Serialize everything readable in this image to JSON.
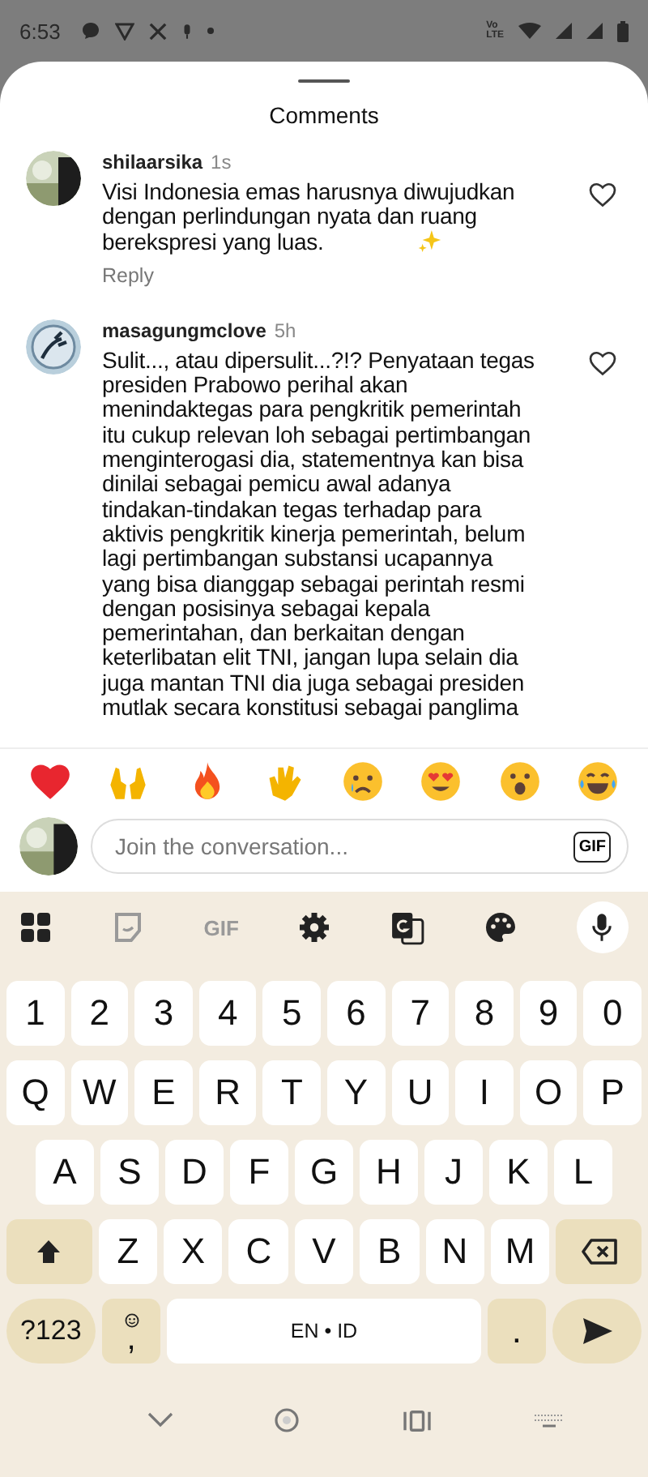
{
  "status_bar": {
    "time": "6:53",
    "network_label": [
      "Vo",
      "LTE"
    ]
  },
  "sheet": {
    "title": "Comments"
  },
  "comments": [
    {
      "username": "shilaarsika",
      "age": "1s",
      "lines": [
        "Visi Indonesia emas harusnya diwujudkan",
        "dengan perlindungan nyata dan ruang",
        "berekspresi yang luas."
      ],
      "sparkle": true,
      "reply": "Reply",
      "liked": false
    },
    {
      "username": "masagungmclove",
      "age": "5h",
      "lines": [
        "Sulit..., atau dipersulit...?!? Penyataan tegas",
        "presiden Prabowo perihal akan",
        "menindaktegas para pengkritik pemerintah",
        "itu cukup relevan loh sebagai pertimbangan",
        "menginterogasi dia, statementnya kan bisa",
        "dinilai sebagai pemicu awal adanya",
        "tindakan-tindakan tegas terhadap para",
        "aktivis pengkritik kinerja pemerintah, belum",
        "lagi pertimbangan substansi ucapannya",
        "yang bisa dianggap sebagai perintah resmi",
        "dengan posisinya sebagai kepala",
        "pemerintahan, dan berkaitan dengan",
        "keterlibatan elit TNI, jangan lupa selain dia",
        "juga mantan TNI dia juga sebagai presiden",
        "mutlak secara konstitusi sebagai panglima"
      ],
      "sparkle": false,
      "liked": false
    }
  ],
  "composer": {
    "placeholder": "Join the conversation...",
    "gif": "GIF"
  },
  "keyboard": {
    "toolbar_gif": "GIF",
    "rows": [
      [
        "1",
        "2",
        "3",
        "4",
        "5",
        "6",
        "7",
        "8",
        "9",
        "0"
      ],
      [
        "Q",
        "W",
        "E",
        "R",
        "T",
        "Y",
        "U",
        "I",
        "O",
        "P"
      ],
      [
        "A",
        "S",
        "D",
        "F",
        "G",
        "H",
        "J",
        "K",
        "L"
      ],
      [
        "Z",
        "X",
        "C",
        "V",
        "B",
        "N",
        "M"
      ]
    ],
    "symbols": "?123",
    "comma": ",",
    "space": "EN • ID",
    "period": "."
  }
}
